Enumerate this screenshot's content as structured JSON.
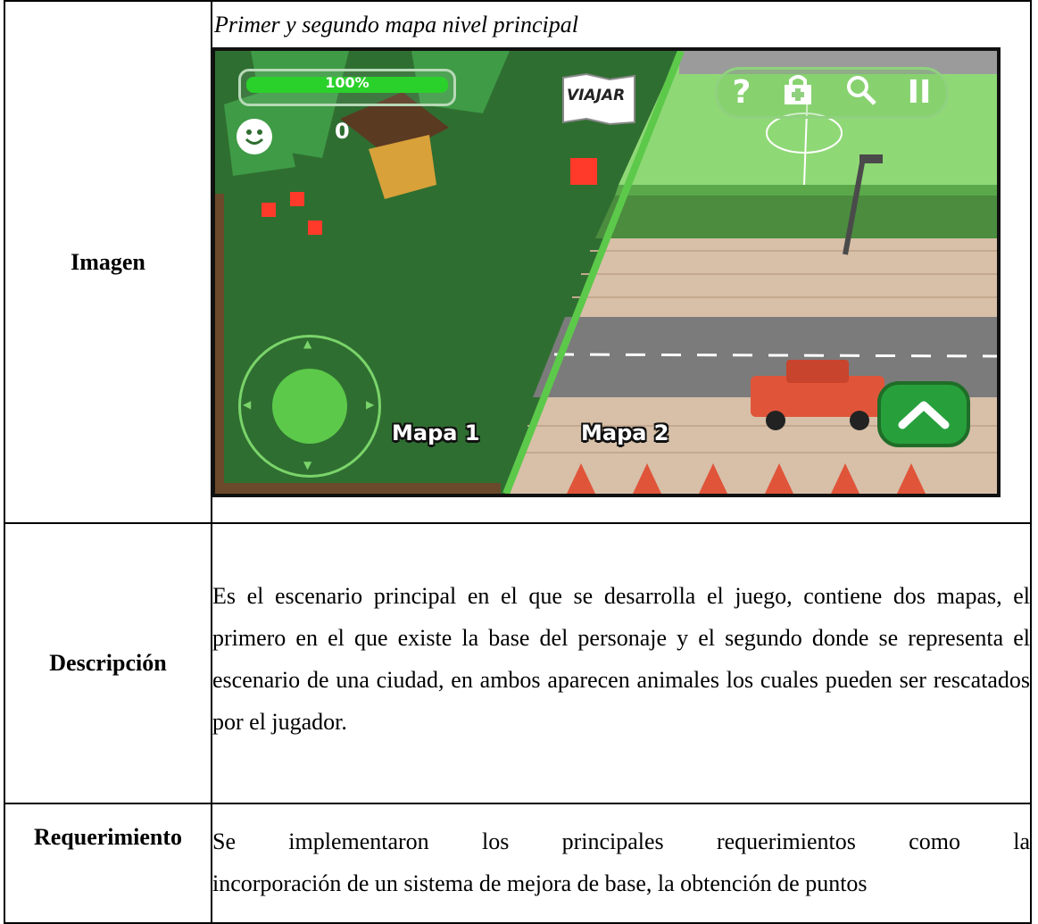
{
  "table": {
    "rows": [
      {
        "label": "Imagen",
        "caption": "Primer y segundo mapa nivel principal"
      },
      {
        "label": "Descripción",
        "text": "Es el escenario principal en el que se desarrolla el juego, contiene dos mapas, el primero en el que existe la base del personaje y el segundo donde se representa el escenario de una ciudad, en ambos aparecen animales los cuales pueden ser rescatados por el jugador."
      },
      {
        "label": "Requerimiento",
        "text_line1": "Se implementaron los principales requerimientos como la",
        "text_line2": "incorporación de un sistema de mejora de base, la obtención de puntos"
      }
    ]
  },
  "game": {
    "health_percent_label": "100%",
    "health_level": 1.0,
    "score": "0",
    "travel_button": "VIAJAR",
    "map1_label": "Mapa 1",
    "map2_label": "Mapa 2",
    "toolbar": {
      "help": "?",
      "pause": "II"
    },
    "colors": {
      "grass_dark": "#2f6e31",
      "field_green": "#8fd876",
      "road": "#7b7b7b",
      "sidewalk": "#d7bfa8",
      "car": "#e0553a",
      "hud_green": "#2bd12b"
    }
  }
}
